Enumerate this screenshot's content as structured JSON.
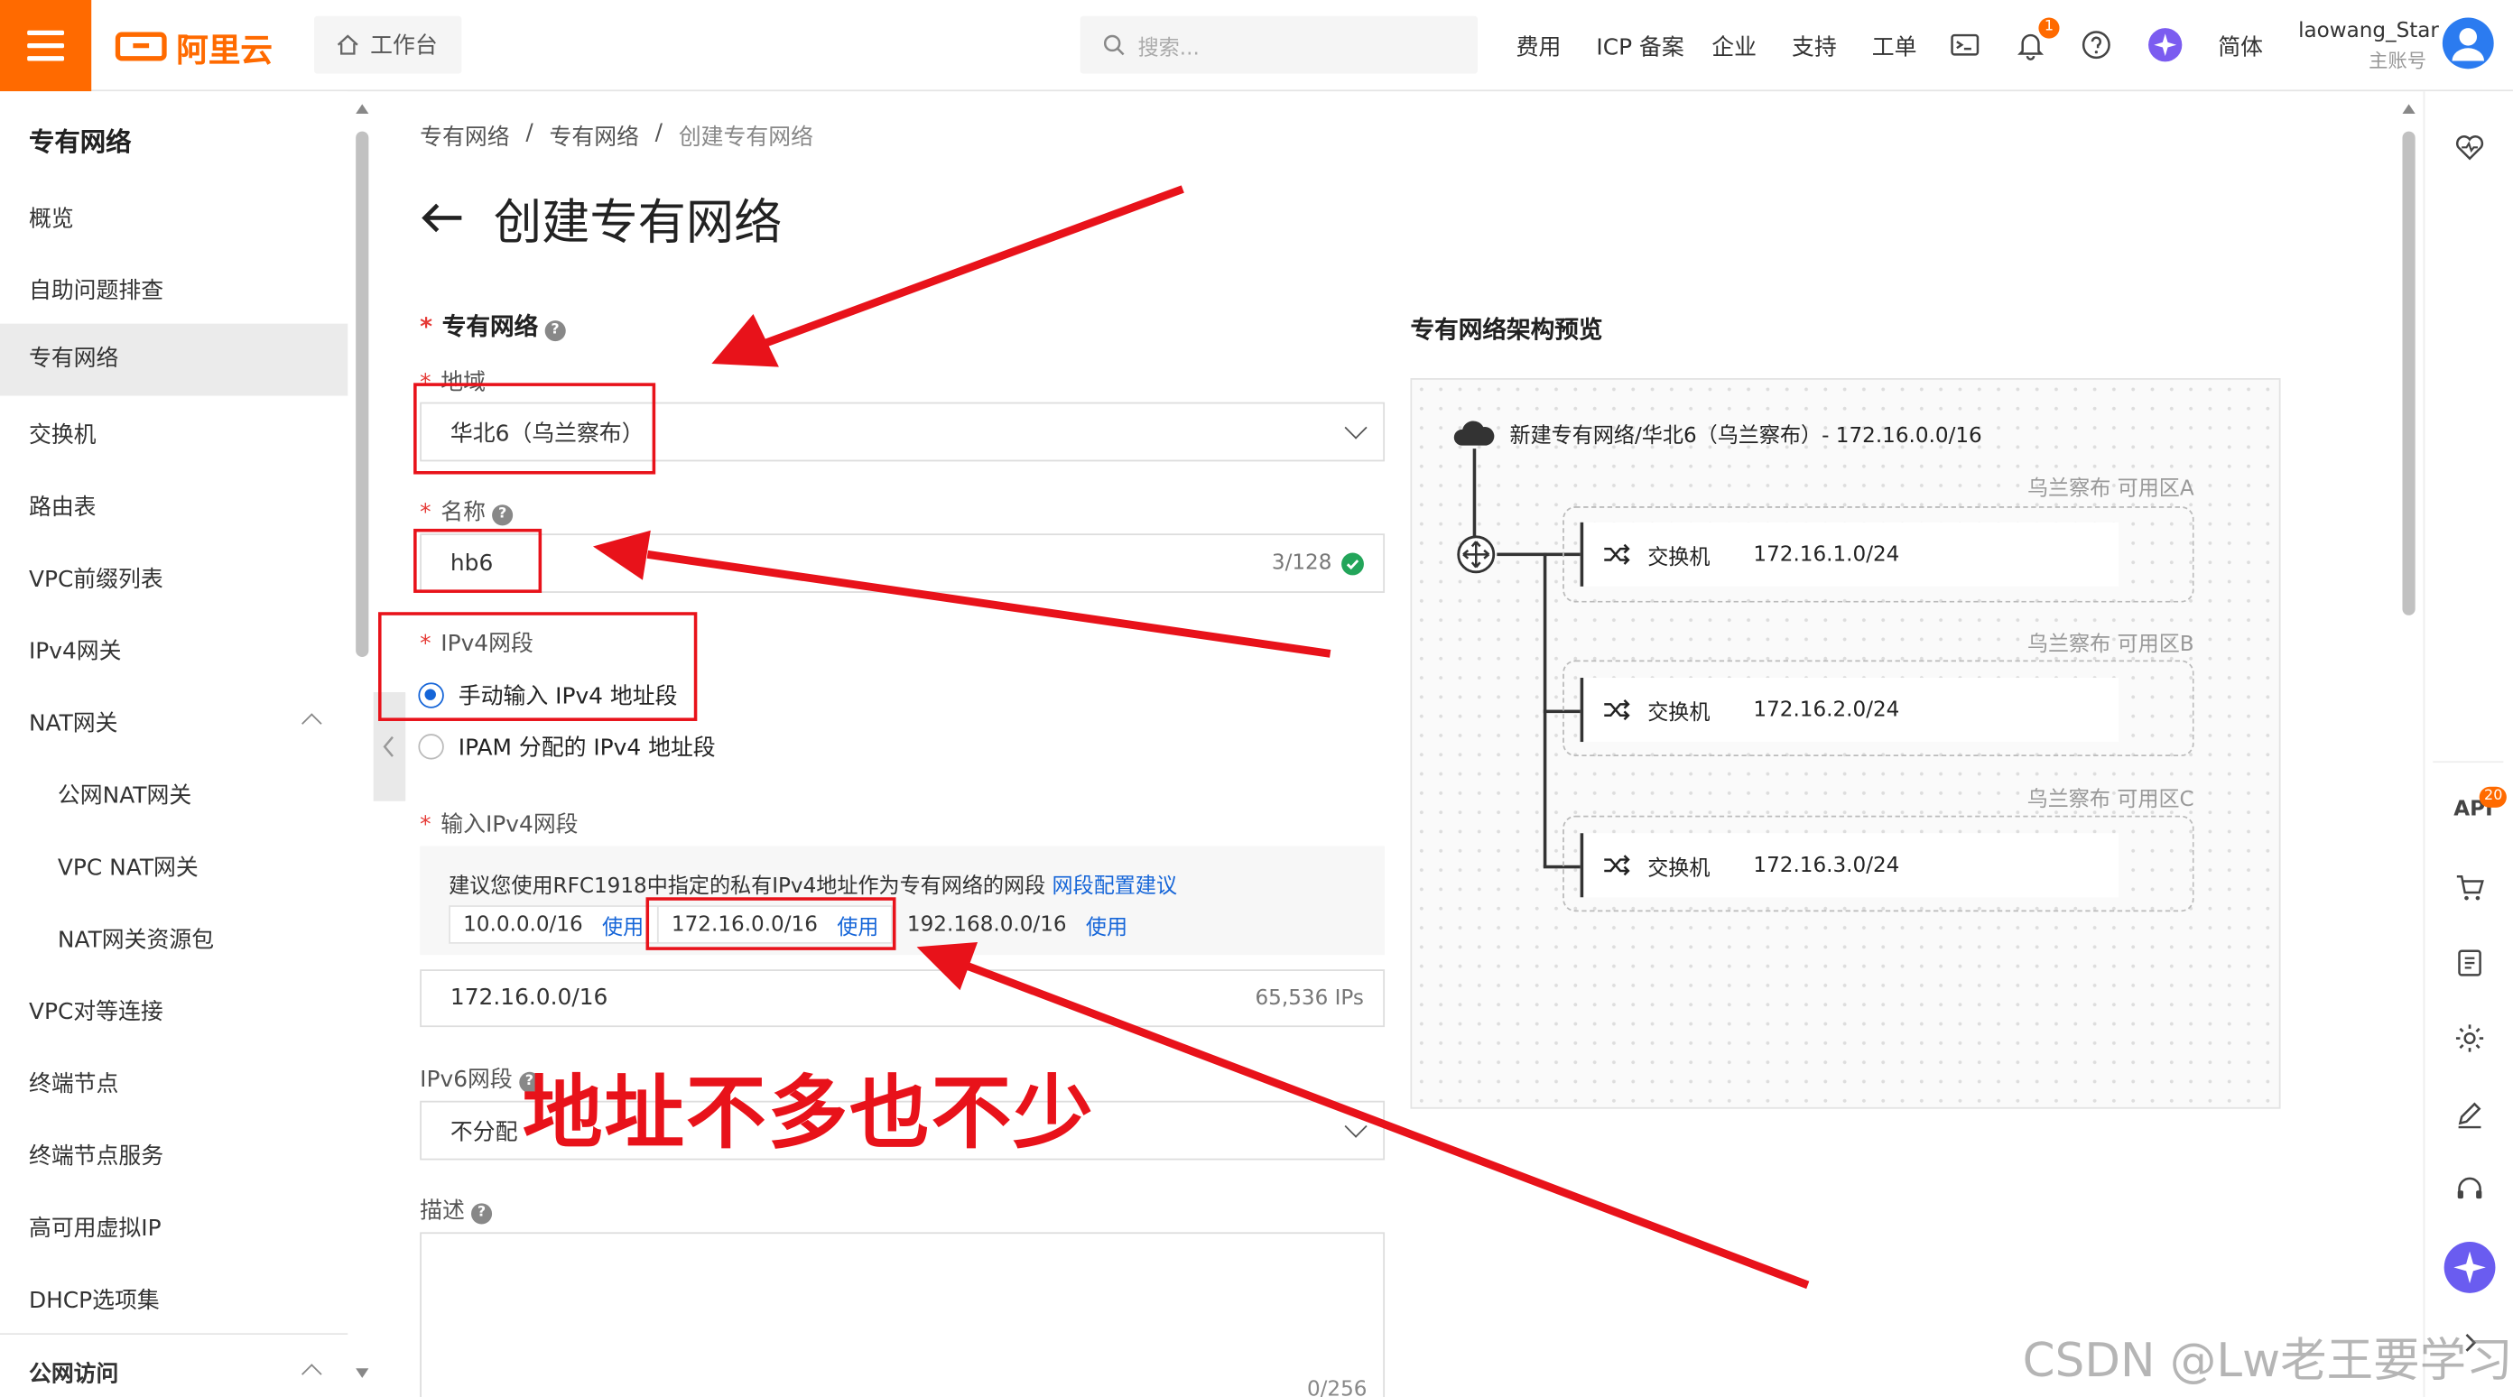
{
  "topbar": {
    "logo": "阿里云",
    "workbench": "工作台",
    "search_placeholder": "搜索...",
    "nav": [
      "费用",
      "ICP 备案",
      "企业",
      "支持",
      "工单"
    ],
    "notification_count": "1",
    "language": "简体",
    "username": "laowang_Star",
    "account_type": "主账号"
  },
  "sidebar": {
    "title": "专有网络",
    "items": [
      {
        "label": "概览"
      },
      {
        "label": "自助问题排查"
      },
      {
        "label": "专有网络"
      },
      {
        "label": "交换机"
      },
      {
        "label": "路由表"
      },
      {
        "label": "VPC前缀列表"
      },
      {
        "label": "IPv4网关"
      },
      {
        "label": "NAT网关"
      },
      {
        "label": "公网NAT网关"
      },
      {
        "label": "VPC NAT网关"
      },
      {
        "label": "NAT网关资源包"
      },
      {
        "label": "VPC对等连接"
      },
      {
        "label": "终端节点"
      },
      {
        "label": "终端节点服务"
      },
      {
        "label": "高可用虚拟IP"
      },
      {
        "label": "DHCP选项集"
      },
      {
        "label": "公网访问"
      }
    ]
  },
  "breadcrumb": [
    "专有网络",
    "专有网络",
    "创建专有网络"
  ],
  "page_title": "创建专有网络",
  "form": {
    "section_title": "专有网络",
    "region_label": "地域",
    "region_value": "华北6（乌兰察布）",
    "name_label": "名称",
    "name_value": "hb6",
    "name_counter": "3/128",
    "ipv4_label": "IPv4网段",
    "ipv4_option_manual": "手动输入 IPv4 地址段",
    "ipv4_option_ipam": "IPAM 分配的 IPv4 地址段",
    "input_ipv4_label": "输入IPv4网段",
    "suggest_text": "建议您使用RFC1918中指定的私有IPv4地址作为专有网络的网段",
    "suggest_link": "网段配置建议",
    "chips": [
      {
        "cidr": "10.0.0.0/16",
        "action": "使用"
      },
      {
        "cidr": "172.16.0.0/16",
        "action": "使用"
      },
      {
        "cidr": "192.168.0.0/16",
        "action": "使用"
      }
    ],
    "cidr_value": "172.16.0.0/16",
    "cidr_ips": "65,536 IPs",
    "ipv6_label": "IPv6网段",
    "ipv6_value": "不分配",
    "desc_label": "描述",
    "desc_counter": "0/256"
  },
  "preview": {
    "title": "专有网络架构预览",
    "vpc_label": "新建专有网络/华北6（乌兰察布）- 172.16.0.0/16",
    "zones": [
      {
        "zone": "乌兰察布 可用区A",
        "switch_label": "交换机",
        "cidr": "172.16.1.0/24"
      },
      {
        "zone": "乌兰察布 可用区B",
        "switch_label": "交换机",
        "cidr": "172.16.2.0/24"
      },
      {
        "zone": "乌兰察布 可用区C",
        "switch_label": "交换机",
        "cidr": "172.16.3.0/24"
      }
    ]
  },
  "rail": {
    "api_label": "API",
    "api_badge": "20"
  },
  "annotation": "地址不多也不少",
  "watermark": "CSDN @Lw老王要学习",
  "colors": {
    "brand": "#ff6a00",
    "link": "#1565d8",
    "annotation": "#e8121a"
  }
}
